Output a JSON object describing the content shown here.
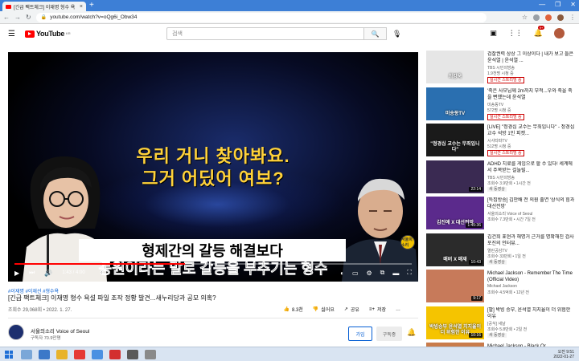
{
  "browser": {
    "tab_title": "[긴급 팩트체크] 이재명 형수 욕",
    "tab_close": "×",
    "new_tab": "+",
    "url": "youtube.com/watch?v=oQg6i_Obw34",
    "window_controls": [
      "—",
      "❐",
      "✕"
    ]
  },
  "header": {
    "logo_text": "YouTube",
    "logo_region": "KR",
    "search_placeholder": "검색",
    "notification_count": "9+"
  },
  "player": {
    "overlay_line1": "우리 거니 찾아봐요.",
    "overlay_line2": "그거 어딨어 여보?",
    "subtitle_line1": "형제간의 갈등 해결보다",
    "subtitle_line2": "동원이라는 말로 갈등을 부추기는 형수",
    "time": "1:43 / 4:00",
    "progress": 0.43,
    "watermark": "서울의소리",
    "accent_color": "#ff0000"
  },
  "video": {
    "hashtags": "#이재명 #이재선 #형수욕",
    "title": "[긴급 팩트체크] 이재명 형수 욕설 파일 조작 정황 발견...새누리당과 공모 의혹?",
    "meta": "조회수 29,068회 • 2022. 1. 27.",
    "likes": "8.3천",
    "dislike_label": "싫어요",
    "share_label": "공유",
    "save_label": "저장",
    "more_label": "…"
  },
  "channel": {
    "name": "서울의소리 Voice of Seoul",
    "subscribers": "구독자 70.9만명",
    "join_label": "가입",
    "subscribe_label": "구독중"
  },
  "recommendations": [
    {
      "title": "검찰권력 상상 그 이상이다 | 내가 보고 들은 윤석열 | 윤석열 ...",
      "channel": "TBS 시민의방송",
      "meta": "1.9천명 시청 중",
      "badge": "실시간 스트리밍 중",
      "badge_type": "live",
      "thumb_text": "최강욱",
      "thumb_bg": "#e6e6e6",
      "duration": ""
    },
    {
      "title": "'죽은 사모님께 2m까지 부적...우와 죽을 죽을 뻔했는데 윤석열",
      "channel": "미송동TV",
      "meta": "572명 시청 중",
      "badge": "실시간 스트리밍 중",
      "badge_type": "live",
      "thumb_text": "미송동TV",
      "thumb_bg": "#2a6fb0",
      "duration": ""
    },
    {
      "title": "[LIVE] \"정경심 교수는 무죄입니다\" - 정경심 교수 석방 1인 피켓...",
      "channel": "시사타파TV",
      "meta": "512명 시청 중",
      "badge": "실시간 스트리밍 중",
      "badge_type": "live",
      "thumb_text": "\"정경심 교수는 무죄입니다\"",
      "thumb_bg": "#1a1a1a",
      "duration": ""
    },
    {
      "title": "ADHD 치료를 게임으로 할 수 있다! 세계에서 주목받는 걸놀릴...",
      "channel": "TBS 시민의방송",
      "meta": "조회수 3.9만회 • 1시간 전",
      "badge": "새 동영상",
      "badge_type": "new",
      "thumb_text": "",
      "thumb_bg": "#3a2a52",
      "duration": "22:14"
    },
    {
      "title": "[특집방송] 김만배 전 의원 출연 '상식의 힘과 대선전망'",
      "channel": "서울의소리 Voice of Seoul",
      "meta": "조회수 7.3만회 • 시간 7일 전",
      "badge": "",
      "badge_type": "",
      "thumb_text": "김진애 X 대선전망",
      "thumb_bg": "#5b2a8c",
      "duration": "1:45:36"
    },
    {
      "title": "김건희 표현과 해명거 근거를 명확해진 검사 포진의 인터뷰...",
      "channel": "열린공감TV",
      "meta": "조회수 33만회 • 1일 전",
      "badge": "새 동영상",
      "badge_type": "new",
      "thumb_text": "매버 X 매재",
      "thumb_bg": "#2b2b2b",
      "duration": "10:43"
    },
    {
      "title": "Michael Jackson - Remember The Time (Official Video)",
      "channel": "Michael Jackson",
      "meta": "조회수 4.5억회 • 12년 전",
      "badge": "",
      "badge_type": "",
      "thumb_text": "",
      "thumb_bg": "#c77a5a",
      "duration": "9:17"
    },
    {
      "title": "[팔] 박빙 승부, 윤석열 치지율이 더 위험한 이유",
      "channel": "[공식] 새날",
      "meta": "조회수 5.8만회 • 2일 전",
      "badge": "새 동영상",
      "badge_type": "new",
      "thumb_text": "박빙승부 윤석열 치지율이 더 위험한 이유",
      "thumb_bg": "#f5c400",
      "duration": "10:16"
    },
    {
      "title": "Michael Jackson - Black Or ...",
      "channel": "",
      "meta": "",
      "badge": "",
      "badge_type": "",
      "thumb_text": "",
      "thumb_bg": "#c97b4a",
      "duration": ""
    }
  ],
  "taskbar": {
    "time": "오전 9:51",
    "date": "2022-01-27",
    "icon_colors": [
      "#7aa7d8",
      "#3c78c8",
      "#e8b32a",
      "#e53935",
      "#4a90e2",
      "#d32f2f",
      "#5a5a5a",
      "#8a8a8a"
    ]
  }
}
